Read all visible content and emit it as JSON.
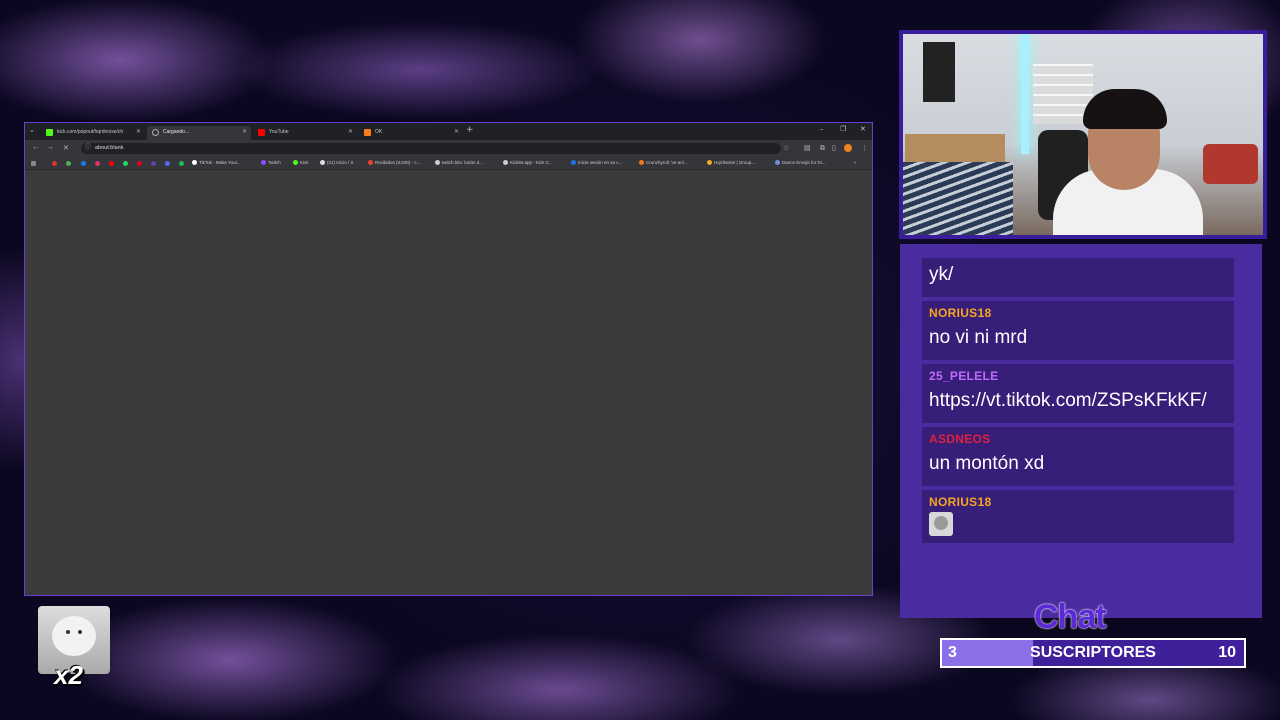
{
  "browser": {
    "tabs": [
      {
        "title": "kick.com/popout/hqrdnoise/ch",
        "favicon_color": "#53fc18",
        "active": false
      },
      {
        "title": "Cargando...",
        "favicon_color": "#888888",
        "active": true
      },
      {
        "title": "YouTube",
        "favicon_color": "#ff0000",
        "active": false
      },
      {
        "title": "OK",
        "favicon_color": "#ff7a1a",
        "active": false
      }
    ],
    "new_tab_icon": "+",
    "address": "about:blank",
    "bookmarks": [
      {
        "label": "TikTok - Make Your...",
        "color": "#ffffff"
      },
      {
        "label": "Twitch",
        "color": "#9146ff"
      },
      {
        "label": "Kick",
        "color": "#53fc18"
      },
      {
        "label": "(21) Inicio / X",
        "color": "#dddddd"
      },
      {
        "label": "Recibidos (3,628) - c...",
        "color": "#ea4335"
      },
      {
        "label": "twitch bits: botón d...",
        "color": "#cccccc"
      },
      {
        "label": "Kicklet.app - Kick C...",
        "color": "#cccccc"
      },
      {
        "label": "Inicie sesión en su c...",
        "color": "#1a73e8"
      },
      {
        "label": "Crunchyroll: Ve ani...",
        "color": "#f47521"
      },
      {
        "label": "HqrdNoise | Group...",
        "color": "#f5a623"
      },
      {
        "label": "Dance Emojis for Di...",
        "color": "#7289da"
      }
    ]
  },
  "chat": {
    "title": "Chat",
    "messages": [
      {
        "user": "",
        "user_color": "#f6a623",
        "text": "yk/",
        "emote": false
      },
      {
        "user": "NORIUS18",
        "user_color": "#f6a623",
        "text": "no vi ni mrd",
        "emote": false
      },
      {
        "user": "25_PELELE",
        "user_color": "#c06bff",
        "text": "https://vt.tiktok.com/ZSPsKFkKF/",
        "emote": false
      },
      {
        "user": "ASDNEOS",
        "user_color": "#e0213a",
        "text": "un montón xd",
        "emote": false
      },
      {
        "user": "NORIUS18",
        "user_color": "#f6a623",
        "text": "",
        "emote": true
      }
    ]
  },
  "sub_goal": {
    "current": "3",
    "label": "SUSCRIPTORES",
    "target": "10",
    "progress_fraction": 0.3
  },
  "overlay_emote": {
    "multiplier": "x2"
  }
}
